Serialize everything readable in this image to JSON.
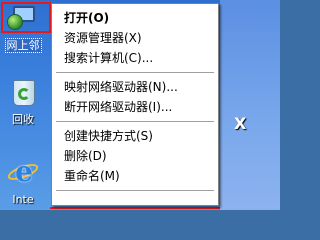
{
  "desktop": {
    "icons": [
      {
        "label": "网上邻",
        "icon": "network-places-icon"
      },
      {
        "label": "回收",
        "icon": "recycle-bin-icon"
      },
      {
        "label": "Inte",
        "icon": "internet-explorer-icon"
      }
    ],
    "right_glyph": "X"
  },
  "context_menu": {
    "items": [
      {
        "label": "打开(O)",
        "default": true
      },
      {
        "label": "资源管理器(X)"
      },
      {
        "label": "搜索计算机(C)..."
      },
      {
        "label": "映射网络驱动器(N)..."
      },
      {
        "label": "断开网络驱动器(I)..."
      },
      {
        "label": "创建快捷方式(S)"
      },
      {
        "label": "删除(D)"
      },
      {
        "label": "重命名(M)"
      }
    ]
  },
  "colors": {
    "highlight": "#e41b1b",
    "selection": "#316ac5",
    "menu_bg": "#ffffff"
  }
}
